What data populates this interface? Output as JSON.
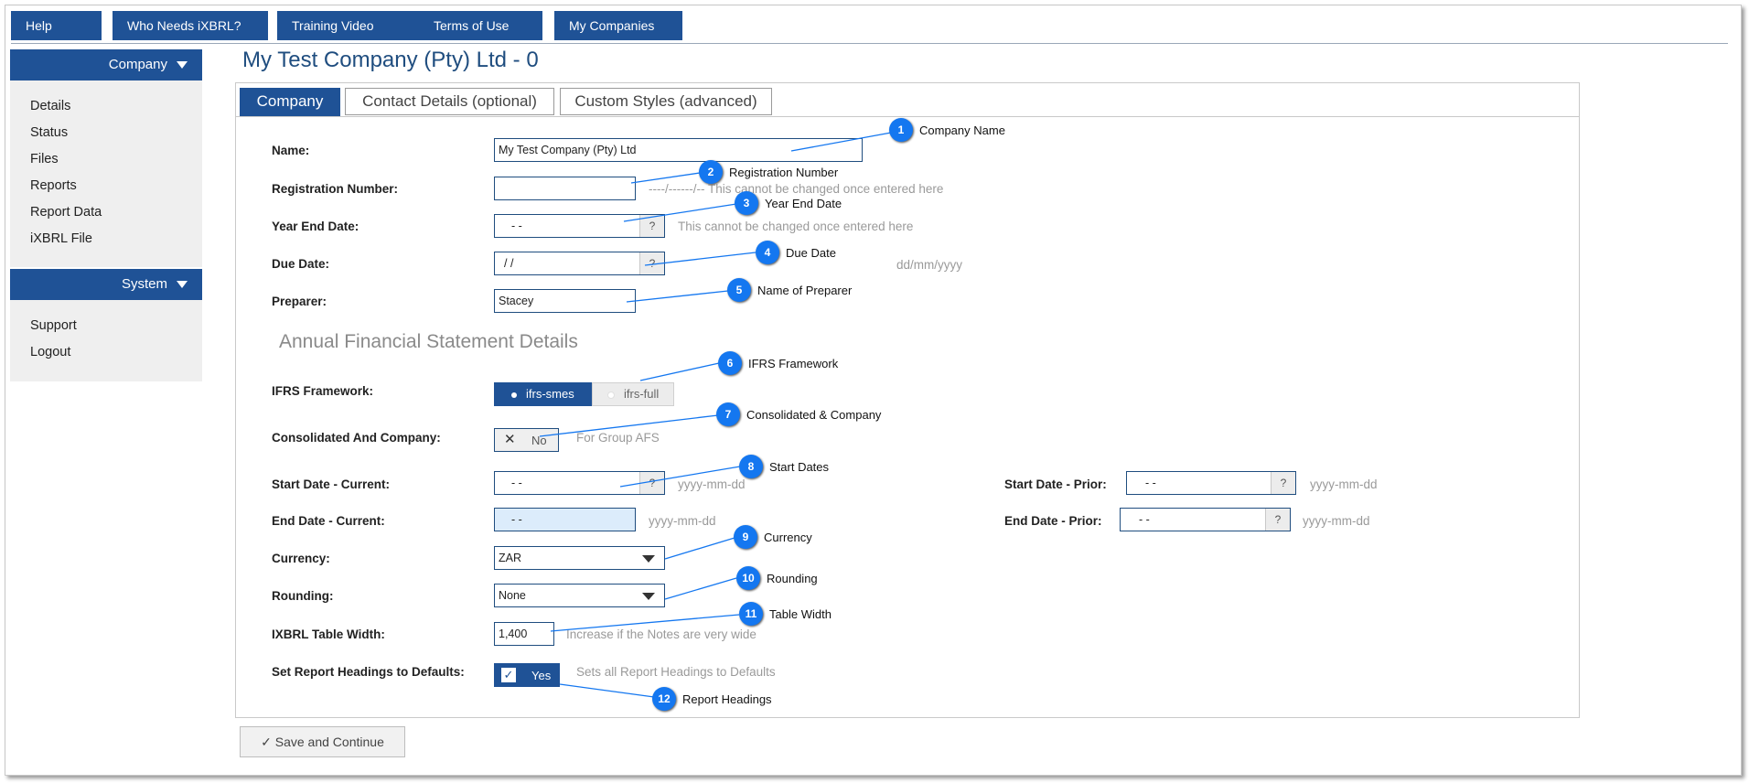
{
  "nav": [
    "Help",
    "Who Needs iXBRL?",
    "Training Video",
    "Terms of Use",
    "My Companies"
  ],
  "sidebar": {
    "company_header": "Company",
    "company_items": [
      "Details",
      "Status",
      "Files",
      "Reports",
      "Report Data",
      "iXBRL File"
    ],
    "system_header": "System",
    "system_items": [
      "Support",
      "Logout"
    ]
  },
  "page_title": "My Test Company (Pty) Ltd - 0",
  "tabs": [
    "Company",
    "Contact Details (optional)",
    "Custom Styles (advanced)"
  ],
  "form": {
    "name_label": "Name:",
    "name_value": "My Test Company (Pty) Ltd",
    "reg_label": "Registration Number:",
    "reg_hint": "----/------/-- This cannot be changed once entered here",
    "ye_label": "Year End Date:",
    "ye_value": "-  -",
    "ye_hint": "This cannot be changed once entered here",
    "due_label": "Due Date:",
    "due_value": " /  /",
    "due_hint": "dd/mm/yyyy",
    "prep_label": "Preparer:",
    "prep_value": "Stacey",
    "section_title": "Annual Financial Statement Details",
    "ifrs_label": "IFRS Framework:",
    "ifrs_on": "ifrs-smes",
    "ifrs_off": "ifrs-full",
    "cons_label": "Consolidated And Company:",
    "cons_value": "No",
    "cons_hint": "For Group AFS",
    "sdc_label": "Start Date - Current:",
    "sdc_value": "-  -",
    "sdc_hint": "yyyy-mm-dd",
    "sdp_label": "Start Date - Prior:",
    "sdp_value": "-  -",
    "sdp_hint": "yyyy-mm-dd",
    "edc_label": "End Date - Current:",
    "edc_value": "-  -",
    "edc_hint": "yyyy-mm-dd",
    "edp_label": "End Date - Prior:",
    "edp_value": "-  -",
    "edp_hint": "yyyy-mm-dd",
    "cur_label": "Currency:",
    "cur_value": "ZAR",
    "round_label": "Rounding:",
    "round_value": "None",
    "tw_label": "IXBRL Table Width:",
    "tw_value": "1,400",
    "tw_hint": "Increase if the Notes are very wide",
    "rh_label": "Set Report Headings to Defaults:",
    "rh_value": "Yes",
    "rh_hint": "Sets all Report Headings to Defaults",
    "question": "?",
    "check_mark": "✓",
    "x_mark": "✕"
  },
  "save_label": "✓  Save and Continue",
  "callouts": [
    {
      "num": "1",
      "label": "Company Name"
    },
    {
      "num": "2",
      "label": "Registration Number"
    },
    {
      "num": "3",
      "label": "Year End Date"
    },
    {
      "num": "4",
      "label": "Due Date"
    },
    {
      "num": "5",
      "label": "Name of Preparer"
    },
    {
      "num": "6",
      "label": "IFRS Framework"
    },
    {
      "num": "7",
      "label": "Consolidated & Company"
    },
    {
      "num": "8",
      "label": "Start Dates"
    },
    {
      "num": "9",
      "label": "Currency"
    },
    {
      "num": "10",
      "label": "Rounding"
    },
    {
      "num": "11",
      "label": "Table Width"
    },
    {
      "num": "12",
      "label": "Report Headings"
    }
  ],
  "colors": {
    "brand": "#1f5296",
    "callout": "#1477f0"
  }
}
